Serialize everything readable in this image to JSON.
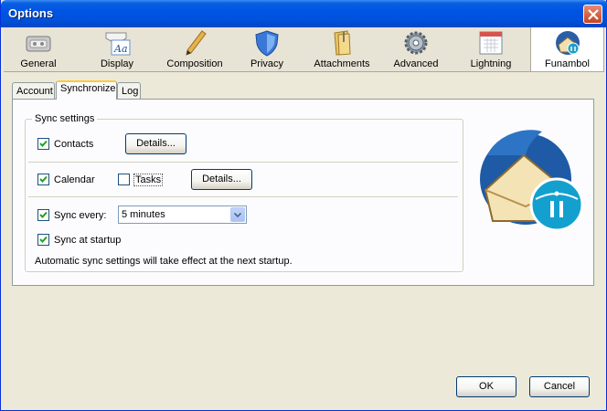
{
  "window": {
    "title": "Options"
  },
  "toolbar": {
    "items": [
      {
        "label": "General",
        "icon": "general-icon"
      },
      {
        "label": "Display",
        "icon": "display-icon"
      },
      {
        "label": "Composition",
        "icon": "composition-icon"
      },
      {
        "label": "Privacy",
        "icon": "privacy-icon"
      },
      {
        "label": "Attachments",
        "icon": "attachments-icon"
      },
      {
        "label": "Advanced",
        "icon": "advanced-icon"
      },
      {
        "label": "Lightning",
        "icon": "lightning-icon"
      },
      {
        "label": "Funambol",
        "icon": "funambol-icon",
        "selected": true
      }
    ]
  },
  "tabs": [
    {
      "label": "Account"
    },
    {
      "label": "Synchronize",
      "active": true
    },
    {
      "label": "Log"
    }
  ],
  "sync": {
    "legend": "Sync settings",
    "contacts": {
      "label": "Contacts",
      "checked": true,
      "details_label": "Details..."
    },
    "calendar": {
      "label": "Calendar",
      "checked": true
    },
    "tasks": {
      "label": "Tasks",
      "checked": false,
      "details_label": "Details..."
    },
    "sync_every": {
      "label": "Sync every:",
      "checked": true,
      "value": "5 minutes"
    },
    "sync_startup": {
      "label": "Sync at startup",
      "checked": true
    },
    "note": "Automatic sync settings will take effect at the next startup."
  },
  "buttons": {
    "ok": "OK",
    "cancel": "Cancel"
  },
  "colors": {
    "titlebar": "#0054e3",
    "face": "#ece9d8",
    "check": "#21a121"
  }
}
